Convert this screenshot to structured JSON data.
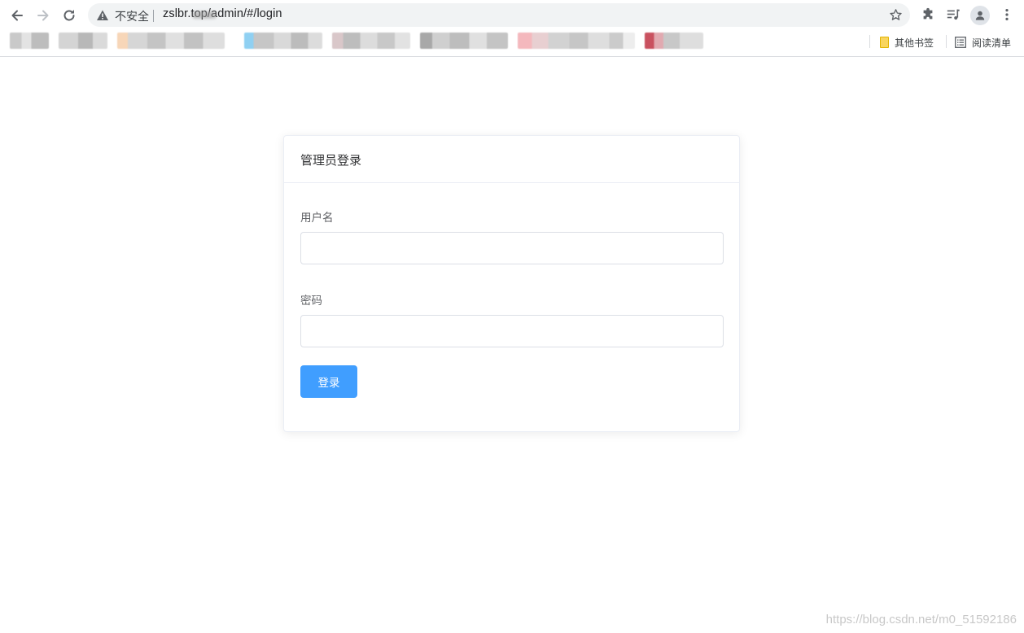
{
  "browser": {
    "security_label": "不安全",
    "url": "zslbr.top/admin/#/login"
  },
  "bookmarks_bar": {
    "other_bookmarks": "其他书签",
    "reading_list": "阅读清单"
  },
  "login_card": {
    "title": "管理员登录",
    "username_label": "用户名",
    "username_value": "",
    "password_label": "密码",
    "password_value": "",
    "login_button": "登录"
  },
  "watermark": "https://blog.csdn.net/m0_51592186",
  "colors": {
    "primary_button": "#409eff",
    "card_border": "#ebeef5",
    "input_border": "#dcdfe6"
  }
}
